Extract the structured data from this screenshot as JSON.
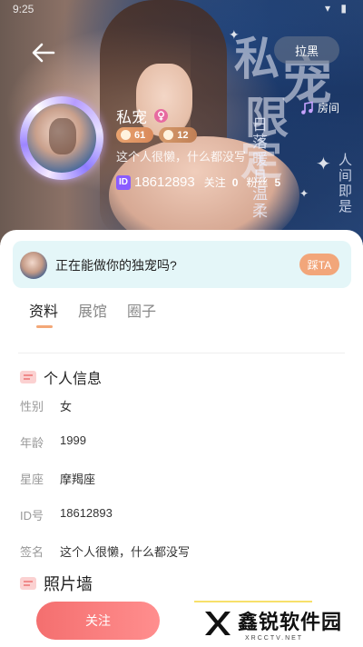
{
  "status_bar": {
    "time": "9:25",
    "icons": "▾ ▮"
  },
  "header": {
    "back_icon": "arrow-left-icon",
    "block_label": "拉黑",
    "room_label": "房间",
    "background_text": [
      "私",
      "宠",
      "限",
      "定"
    ],
    "background_vertical": [
      "日落暖且温柔",
      "人间即是"
    ]
  },
  "profile": {
    "name": "私宠",
    "gender_icon": "female-icon",
    "wealth_level": "61",
    "charm_level": "12",
    "signature": "这个人很懒，什么都没写",
    "id_badge": "ID",
    "id": "18612893",
    "following_label": "关注",
    "following_count": "0",
    "fans_label": "粉丝",
    "fans_count": "5"
  },
  "notice": {
    "text": "正在能做你的独宠吗?",
    "button": "踩TA"
  },
  "tabs": [
    {
      "label": "资料",
      "active": true
    },
    {
      "label": "展馆",
      "active": false
    },
    {
      "label": "圈子",
      "active": false
    }
  ],
  "personal_info": {
    "title": "个人信息",
    "rows": [
      {
        "label": "性别",
        "value": "女"
      },
      {
        "label": "年龄",
        "value": "1999"
      },
      {
        "label": "星座",
        "value": "摩羯座"
      },
      {
        "label": "ID号",
        "value": "18612893"
      },
      {
        "label": "签名",
        "value": "这个人很懒，什么都没写"
      }
    ]
  },
  "photo_wall": {
    "title": "照片墙"
  },
  "bottom": {
    "follow_label": "关注"
  },
  "watermark": {
    "name": "鑫锐软件园",
    "url": "XRCCTV.NET"
  },
  "colors": {
    "accent": "#f3a777",
    "follow": "#f46f6f",
    "notice_bg": "#e4f6f8",
    "id_badge": "#8a5cff"
  }
}
